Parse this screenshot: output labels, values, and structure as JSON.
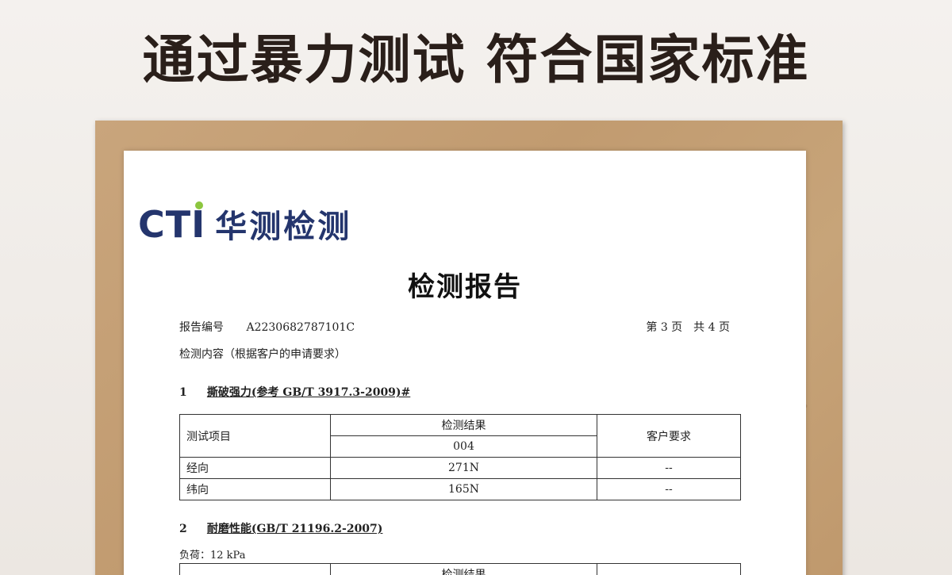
{
  "headline": "通过暴力测试 符合国家标准",
  "logo": {
    "brand": "CTI",
    "chinese_name": "华测检测"
  },
  "report": {
    "title": "检测报告",
    "number_label": "报告编号",
    "number_value": "A2230682787101C",
    "page_info": "第 3 页　共 4 页",
    "content_line": "检测内容（根据客户的申请要求）"
  },
  "section1": {
    "number": "1",
    "title": "撕破强力(参考 GB/T 3917.3-2009)#",
    "table": {
      "col_item": "测试项目",
      "col_result": "检测结果",
      "sample_id": "004",
      "col_requirement": "客户要求",
      "rows": [
        {
          "item": "经向",
          "result": "271N",
          "requirement": "--"
        },
        {
          "item": "纬向",
          "result": "165N",
          "requirement": "--"
        }
      ]
    }
  },
  "section2": {
    "number": "2",
    "title": "耐磨性能(GB/T 21196.2-2007)",
    "load": "负荷：12 kPa",
    "table": {
      "col_result": "检测结果"
    }
  }
}
